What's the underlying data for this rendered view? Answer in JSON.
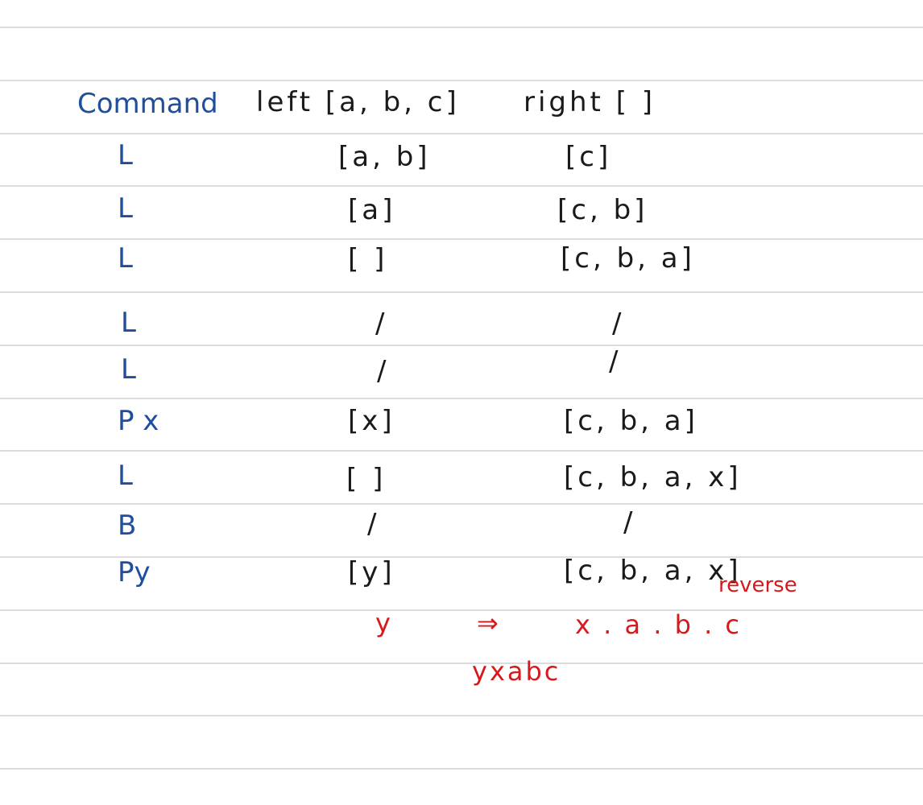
{
  "header": {
    "command": "Command",
    "left": "left [a, b, c]",
    "right": "right [   ]"
  },
  "rows": [
    {
      "command": "L",
      "left": "[a, b]",
      "right": "[c]"
    },
    {
      "command": "L",
      "left": "[a]",
      "right": "[c, b]"
    },
    {
      "command": "L",
      "left": "[ ]",
      "right": "[c, b, a]"
    },
    {
      "command": "L",
      "left": "/",
      "right": "/"
    },
    {
      "command": "L",
      "left": "/",
      "right": "/"
    },
    {
      "command": "P x",
      "left": "[x]",
      "right": "[c, b, a]"
    },
    {
      "command": "L",
      "left": "[ ]",
      "right": "[c, b, a, x]"
    },
    {
      "command": "B",
      "left": "/",
      "right": "/"
    },
    {
      "command": "Py",
      "left": "[y]",
      "right": "[c, b, a, x]"
    }
  ],
  "annotations": {
    "reverse": "reverse",
    "left_result": "y",
    "arrow": "⇒",
    "right_result": "x . a . b . c",
    "final": "yxabc"
  },
  "colors": {
    "rule": "#dcdcdc",
    "command_ink": "#1f4e9c",
    "black_ink": "#1a1a1a",
    "red_ink": "#d7191c"
  }
}
